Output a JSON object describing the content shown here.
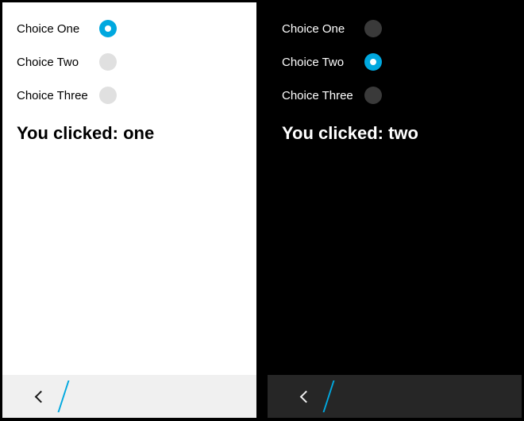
{
  "screens": {
    "light": {
      "options": [
        {
          "label": "Choice One",
          "selected": true
        },
        {
          "label": "Choice Two",
          "selected": false
        },
        {
          "label": "Choice Three",
          "selected": false
        }
      ],
      "status": "You clicked: one"
    },
    "dark": {
      "options": [
        {
          "label": "Choice One",
          "selected": false
        },
        {
          "label": "Choice Two",
          "selected": true
        },
        {
          "label": "Choice Three",
          "selected": false
        }
      ],
      "status": "You clicked: two"
    }
  },
  "colors": {
    "accent": "#00a8df",
    "light_bg": "#ffffff",
    "dark_bg": "#000000",
    "light_bar": "#f0f0f0",
    "dark_bar": "#262626",
    "light_radio_unselected": "#e0e0e0",
    "dark_radio_unselected": "#3a3a3a"
  }
}
